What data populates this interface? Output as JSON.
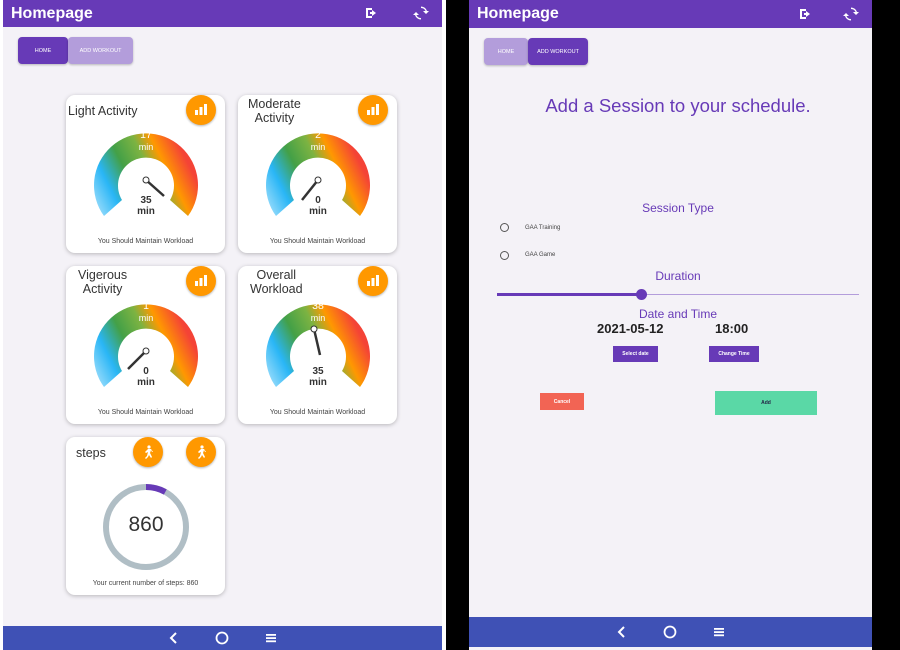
{
  "left": {
    "appbar": {
      "title": "Homepage"
    },
    "tabs": {
      "home": "HOME",
      "add_workout": "ADD WORKOUT"
    },
    "cards": [
      {
        "title_line1": "Light Activity",
        "title_line2": "",
        "value": "17",
        "value_unit": "min",
        "target": "35",
        "target_unit": "min",
        "footer": "You Should Maintain Workload"
      },
      {
        "title_line1": "Moderate",
        "title_line2": "Activity",
        "value": "2",
        "value_unit": "min",
        "target": "0",
        "target_unit": "min",
        "footer": "You Should Maintain Workload"
      },
      {
        "title_line1": "Vigerous",
        "title_line2": "Activity",
        "value": "1",
        "value_unit": "min",
        "target": "0",
        "target_unit": "min",
        "footer": "You Should Maintain Workload"
      },
      {
        "title_line1": "Overall",
        "title_line2": "Workload",
        "value": "38",
        "value_unit": "min",
        "target": "35",
        "target_unit": "min",
        "footer": "You Should Maintain Workload"
      }
    ],
    "steps": {
      "title": "steps",
      "count": "860",
      "footer": "Your current number of steps: 860",
      "progress": 0.08
    }
  },
  "right": {
    "appbar": {
      "title": "Homepage"
    },
    "tabs": {
      "home": "HOME",
      "add_workout": "ADD WORKOUT"
    },
    "heading": "Add a Session to your schedule.",
    "session_type": {
      "label": "Session Type",
      "options": [
        "GAA Training",
        "GAA Game"
      ]
    },
    "duration": {
      "label": "Duration",
      "slider_value": 0.4
    },
    "datetime": {
      "label": "Date and Time",
      "date": "2021-05-12",
      "time": "18:00",
      "select_date": "Select date",
      "change_time": "Change Time"
    },
    "buttons": {
      "cancel": "Cancel",
      "add": "Add"
    }
  },
  "colors": {
    "primary": "#673ab7",
    "primary_light": "#b39ddb",
    "accent": "#ff9800",
    "navbar": "#3f51b5",
    "cancel": "#f44336",
    "add": "#5ad8a6"
  }
}
